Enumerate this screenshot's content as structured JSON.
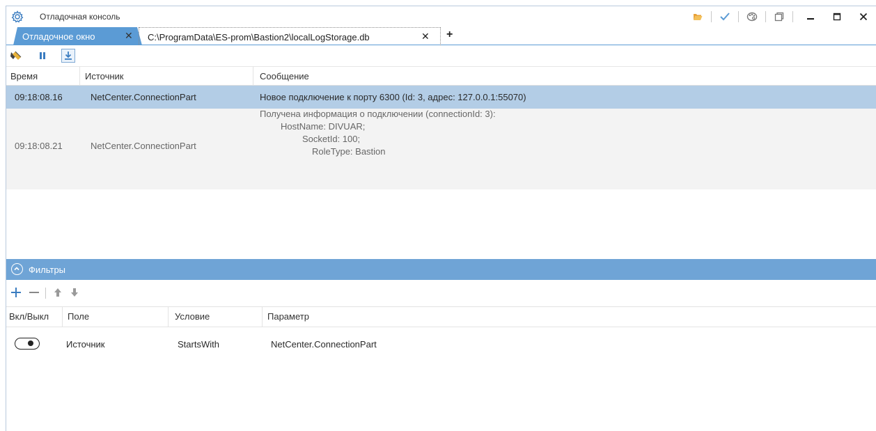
{
  "window": {
    "title": "Отладочная консоль",
    "icons": [
      "folder-open-icon",
      "check-icon",
      "palette-icon",
      "restore-window-icon"
    ],
    "controls": [
      "minimize-icon",
      "maximize-icon",
      "close-icon"
    ]
  },
  "tabs": [
    {
      "label": "Отладочное окно",
      "close": "✕",
      "active": true
    },
    {
      "label": "C:\\ProgramData\\ES-prom\\Bastion2\\localLogStorage.db",
      "close": "✕",
      "active": false
    }
  ],
  "tab_add": "+",
  "toolbar": {
    "icons": [
      "clear-log-icon",
      "pause-icon",
      "autoscroll-download-icon"
    ]
  },
  "log": {
    "columns": [
      "Время",
      "Источник",
      "Сообщение"
    ],
    "rows": [
      {
        "time": "09:18:08.16",
        "source": "NetCenter.ConnectionPart",
        "message": [
          "Новое подключение к порту 6300 (Id: 3, адрес: 127.0.0.1:55070)"
        ]
      },
      {
        "time": "09:18:08.21",
        "source": "NetCenter.ConnectionPart",
        "message": [
          "Получена информация о подключении (connectionId: 3):",
          "HostName: DIVUAR;",
          "SocketId: 100;",
          "RoleType: Bastion"
        ]
      }
    ]
  },
  "filters": {
    "title": "Фильтры",
    "toolbar_icons": [
      "add-icon",
      "remove-icon",
      "move-up-icon",
      "move-down-icon"
    ],
    "columns": [
      "Вкл/Выкл",
      "Поле",
      "Условие",
      "Параметр"
    ],
    "rows": [
      {
        "enabled": true,
        "field": "Источник",
        "condition": "StartsWith",
        "parameter": "NetCenter.ConnectionPart"
      }
    ]
  },
  "colors": {
    "accent": "#5b9bd5",
    "selected_row": "#b3cde6",
    "filters_bar": "#6fa4d6"
  }
}
